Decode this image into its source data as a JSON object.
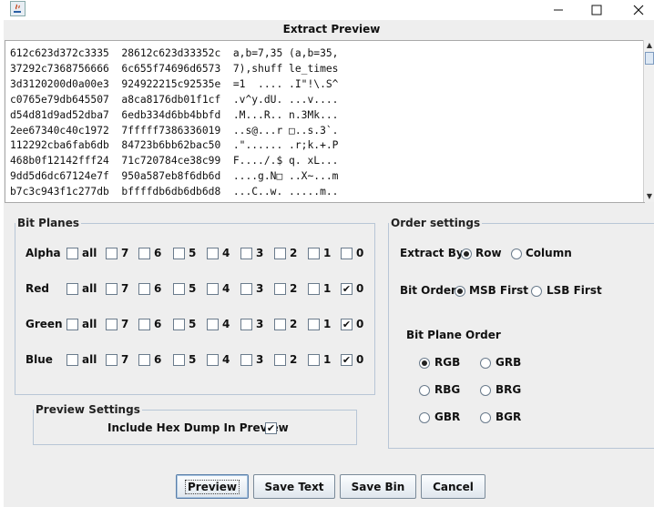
{
  "window": {
    "preview_title": "Extract Preview",
    "controls": [
      "minimize-icon",
      "maximize-icon",
      "close-icon"
    ]
  },
  "hex_lines": [
    "612c623d372c3335  28612c623d33352c  a,b=7,35 (a,b=35,",
    "37292c7368756666  6c655f74696d6573  7),shuff le_times",
    "3d3120200d0a00e3  924922215c92535e  =1  .... .I\"!\\.S^",
    "c0765e79db645507  a8ca8176db01f1cf  .v^y.dU. ...v....",
    "d54d81d9ad52dba7  6edb334d6bb4bbfd  .M...R.. n.3Mk...",
    "2ee67340c40c1972  7fffff7386336019  ..s@...r □..s.3`.",
    "112292cba6fab6db  84723b6bb62bac50  .\"...... .r;k.+.P",
    "468b0f12142fff24  71c720784ce38c99  F..../.$ q. xL...",
    "9dd5d6dc67124e7f  950a587eb8f6db6d  ....g.N□ ..X~...m",
    "b7c3c943f1c277db  bffffdb6db6db6d8  ...C..w. .....m.."
  ],
  "bit_planes": {
    "legend": "Bit Planes",
    "columns": [
      "all",
      "7",
      "6",
      "5",
      "4",
      "3",
      "2",
      "1",
      "0"
    ],
    "rows": [
      {
        "label": "Alpha",
        "checked": [
          false,
          false,
          false,
          false,
          false,
          false,
          false,
          false,
          false
        ]
      },
      {
        "label": "Red",
        "checked": [
          false,
          false,
          false,
          false,
          false,
          false,
          false,
          false,
          true
        ]
      },
      {
        "label": "Green",
        "checked": [
          false,
          false,
          false,
          false,
          false,
          false,
          false,
          false,
          true
        ]
      },
      {
        "label": "Blue",
        "checked": [
          false,
          false,
          false,
          false,
          false,
          false,
          false,
          false,
          true
        ]
      }
    ]
  },
  "preview_settings": {
    "legend": "Preview Settings",
    "include_hex_label": "Include Hex Dump In Preview",
    "include_hex_checked": true
  },
  "order_settings": {
    "legend": "Order settings",
    "extract_by_label": "Extract By",
    "extract_by_options": [
      "Row",
      "Column"
    ],
    "extract_by_selected": "Row",
    "bit_order_label": "Bit Order",
    "bit_order_options": [
      "MSB First",
      "LSB First"
    ],
    "bit_order_selected": "MSB First",
    "plane_order_label": "Bit Plane Order",
    "plane_order_options": [
      "RGB",
      "GRB",
      "RBG",
      "BRG",
      "GBR",
      "BGR"
    ],
    "plane_order_selected": "RGB"
  },
  "buttons": {
    "preview": "Preview",
    "save_text": "Save Text",
    "save_bin": "Save Bin",
    "cancel": "Cancel"
  }
}
